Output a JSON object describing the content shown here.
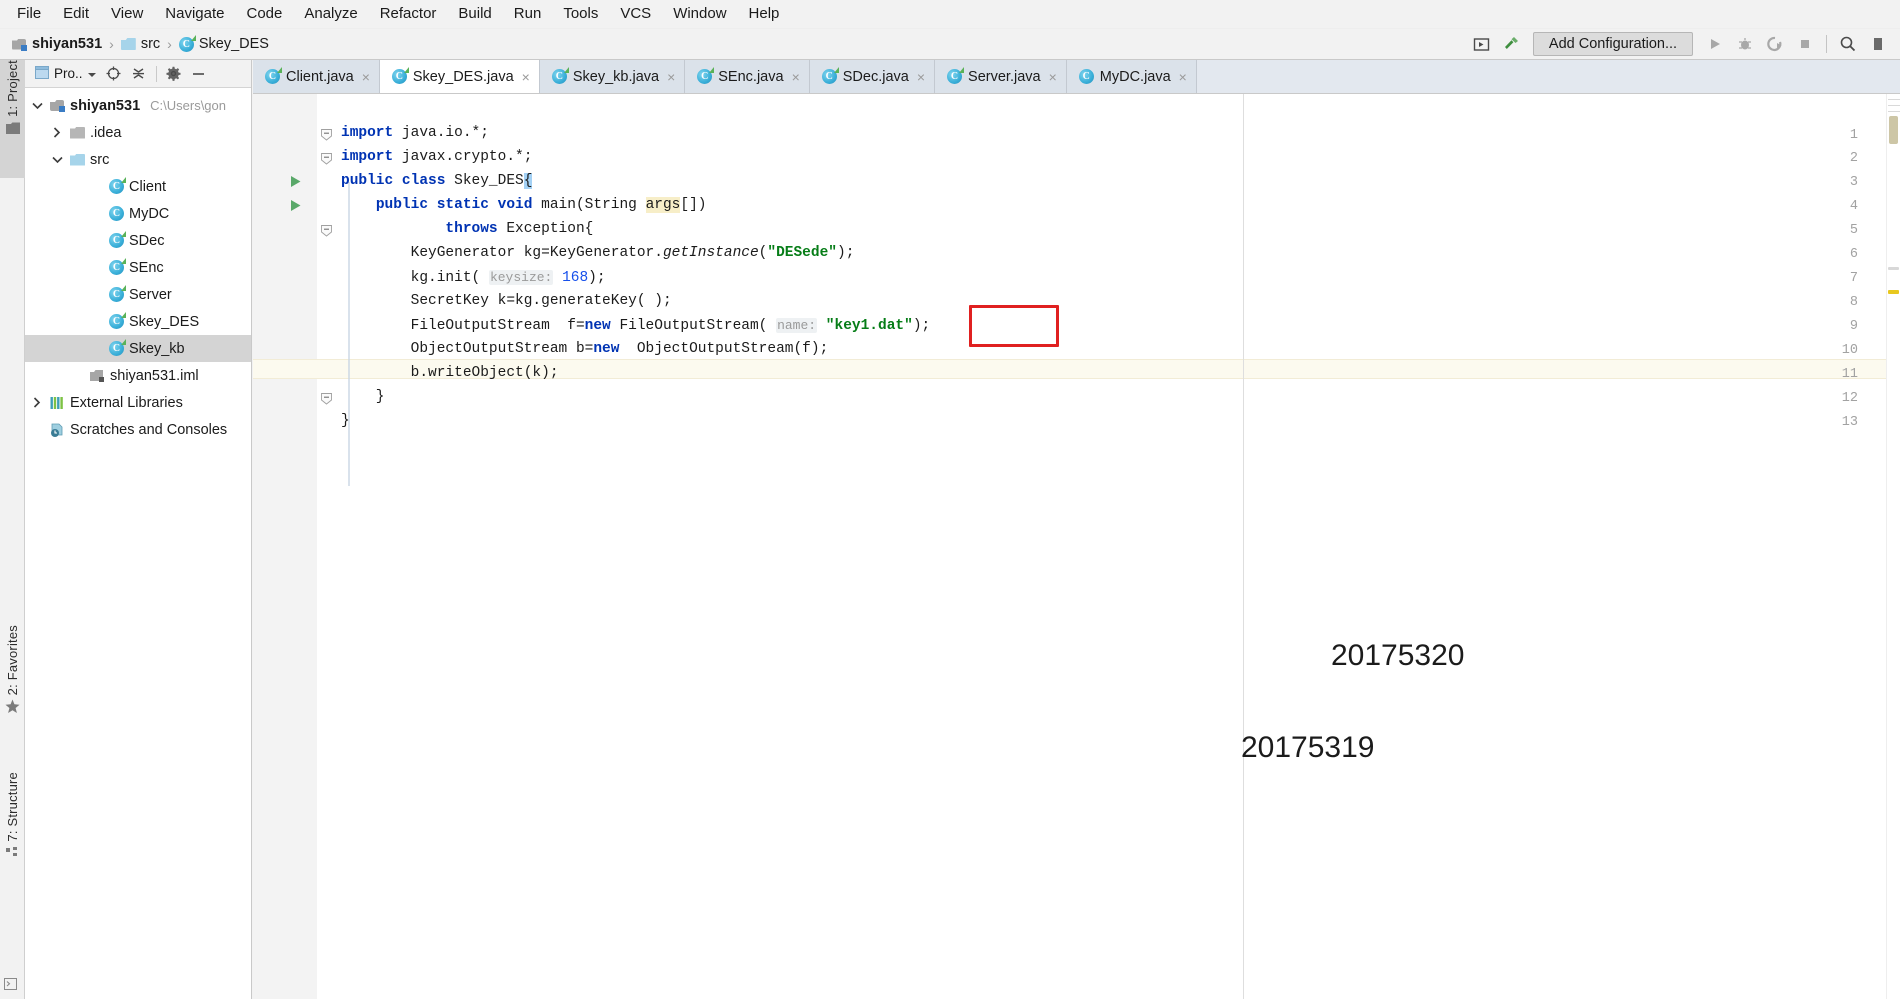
{
  "window": {
    "title": "shiyan531 - Skey_DES.java"
  },
  "menubar": {
    "items": [
      {
        "label": "File"
      },
      {
        "label": "Edit"
      },
      {
        "label": "View"
      },
      {
        "label": "Navigate"
      },
      {
        "label": "Code"
      },
      {
        "label": "Analyze"
      },
      {
        "label": "Refactor"
      },
      {
        "label": "Build"
      },
      {
        "label": "Run"
      },
      {
        "label": "Tools"
      },
      {
        "label": "VCS"
      },
      {
        "label": "Window"
      },
      {
        "label": "Help"
      }
    ]
  },
  "navbar": {
    "breadcrumbs": [
      {
        "label": "shiyan531",
        "icon": "module-icon",
        "bold": true
      },
      {
        "label": "src",
        "icon": "folder-icon",
        "bold": false
      },
      {
        "label": "Skey_DES",
        "icon": "java-class-icon",
        "bold": false
      }
    ],
    "separator": "›",
    "run_config": {
      "label": "Add Configuration...",
      "placeholder": "Add Configuration..."
    },
    "buttons": [
      {
        "name": "select-in-icon",
        "label": ""
      },
      {
        "name": "build-hammer-icon",
        "label": ""
      },
      {
        "name": "run-icon",
        "label": ""
      },
      {
        "name": "debug-icon",
        "label": ""
      },
      {
        "name": "run-with-coverage-icon",
        "label": ""
      },
      {
        "name": "stop-icon",
        "label": ""
      },
      {
        "name": "search-everywhere-icon",
        "label": ""
      }
    ]
  },
  "left_stripe": {
    "buttons": [
      {
        "label": "1: Project",
        "icon": "project-icon",
        "active": true
      },
      {
        "label": "2: Favorites",
        "icon": "star-icon",
        "active": false
      },
      {
        "label": "7: Structure",
        "icon": "structure-icon",
        "active": false
      }
    ]
  },
  "project_panel": {
    "toolbar": {
      "title": "Pro..",
      "icons": [
        {
          "name": "project-view-icon"
        },
        {
          "name": "locate-target-icon"
        },
        {
          "name": "collapse-all-icon"
        },
        {
          "name": "settings-gear-icon"
        },
        {
          "name": "hide-panel-icon"
        }
      ]
    },
    "tree": [
      {
        "label": "shiyan531",
        "path": "C:\\Users\\gon",
        "icon": "module-icon",
        "indent": 0,
        "twisty": "expanded",
        "bold": true,
        "selected": false
      },
      {
        "label": ".idea",
        "path": "",
        "icon": "folder-grey-icon",
        "indent": 1,
        "twisty": "collapsed",
        "bold": false,
        "selected": false
      },
      {
        "label": "src",
        "path": "",
        "icon": "folder-icon",
        "indent": 1,
        "twisty": "expanded",
        "bold": false,
        "selected": false
      },
      {
        "label": "Client",
        "path": "",
        "icon": "java-class-public-icon",
        "indent": 2,
        "twisty": "none",
        "bold": false,
        "selected": false
      },
      {
        "label": "MyDC",
        "path": "",
        "icon": "java-class-icon",
        "indent": 2,
        "twisty": "none",
        "bold": false,
        "selected": false
      },
      {
        "label": "SDec",
        "path": "",
        "icon": "java-class-public-icon",
        "indent": 2,
        "twisty": "none",
        "bold": false,
        "selected": false
      },
      {
        "label": "SEnc",
        "path": "",
        "icon": "java-class-public-icon",
        "indent": 2,
        "twisty": "none",
        "bold": false,
        "selected": false
      },
      {
        "label": "Server",
        "path": "",
        "icon": "java-class-public-icon",
        "indent": 2,
        "twisty": "none",
        "bold": false,
        "selected": false
      },
      {
        "label": "Skey_DES",
        "path": "",
        "icon": "java-class-public-icon",
        "indent": 2,
        "twisty": "none",
        "bold": false,
        "selected": false
      },
      {
        "label": "Skey_kb",
        "path": "",
        "icon": "java-class-public-icon",
        "indent": 2,
        "twisty": "none",
        "bold": false,
        "selected": true
      },
      {
        "label": "shiyan531.iml",
        "path": "",
        "icon": "iml-file-icon",
        "indent": 1,
        "twisty": "none",
        "bold": false,
        "selected": false
      },
      {
        "label": "External Libraries",
        "path": "",
        "icon": "libraries-icon",
        "indent": 0,
        "twisty": "collapsed",
        "bold": false,
        "selected": false
      },
      {
        "label": "Scratches and Consoles",
        "path": "",
        "icon": "scratches-icon",
        "indent": 0,
        "twisty": "none",
        "bold": false,
        "selected": false
      }
    ]
  },
  "editor": {
    "tabs": [
      {
        "label": "Client.java",
        "icon": "java-class-public-icon",
        "active": false
      },
      {
        "label": "Skey_DES.java",
        "icon": "java-class-public-icon",
        "active": true
      },
      {
        "label": "Skey_kb.java",
        "icon": "java-class-public-icon",
        "active": false
      },
      {
        "label": "SEnc.java",
        "icon": "java-class-public-icon",
        "active": false
      },
      {
        "label": "SDec.java",
        "icon": "java-class-public-icon",
        "active": false
      },
      {
        "label": "Server.java",
        "icon": "java-class-public-icon",
        "active": false
      },
      {
        "label": "MyDC.java",
        "icon": "java-class-icon",
        "active": false
      }
    ],
    "close_glyph": "×",
    "line_numbers": [
      "1",
      "2",
      "3",
      "4",
      "5",
      "6",
      "7",
      "8",
      "9",
      "10",
      "11",
      "12",
      "13"
    ],
    "current_line": 13,
    "code_lines": [
      {
        "n": 1,
        "text": "import java.io.*;"
      },
      {
        "n": 2,
        "text": "import javax.crypto.*;"
      },
      {
        "n": 3,
        "text": "public class Skey_DES{"
      },
      {
        "n": 4,
        "text": "    public static void main(String args[])"
      },
      {
        "n": 5,
        "text": "            throws Exception{"
      },
      {
        "n": 6,
        "text": "        KeyGenerator kg=KeyGenerator.getInstance(\"DESede\");"
      },
      {
        "n": 7,
        "text": "        kg.init( keysize: 168);"
      },
      {
        "n": 8,
        "text": "        SecretKey k=kg.generateKey( );"
      },
      {
        "n": 9,
        "text": "        FileOutputStream  f=new FileOutputStream( name: \"key1.dat\");"
      },
      {
        "n": 10,
        "text": "        ObjectOutputStream b=new  ObjectOutputStream(f);"
      },
      {
        "n": 11,
        "text": "        b.writeObject(k);"
      },
      {
        "n": 12,
        "text": "    }"
      },
      {
        "n": 13,
        "text": "}"
      }
    ],
    "parameter_hints": [
      {
        "line": 7,
        "name": "keysize:"
      },
      {
        "line": 9,
        "name": "name:"
      }
    ],
    "string_literals": [
      "\"DESede\"",
      "\"key1.dat\""
    ],
    "highlighted_token": "args",
    "run_gutter_lines": [
      3,
      4
    ],
    "annotation_box": {
      "target": "\"DESede\"",
      "color": "#e02020"
    }
  },
  "annotations": [
    {
      "text": "20175320"
    },
    {
      "text": "20175319"
    }
  ]
}
